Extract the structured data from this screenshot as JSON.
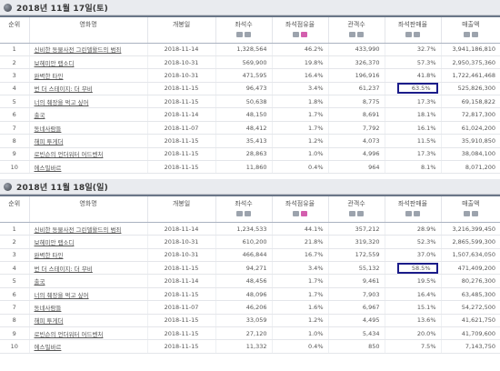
{
  "columns": [
    "순위",
    "영화명",
    "개봉일",
    "좌석수",
    "좌석점유율",
    "관객수",
    "좌석판매율",
    "매출액"
  ],
  "days": [
    {
      "title": "2018년 11월 17일(토)",
      "rows": [
        {
          "rank": "1",
          "title": "신비한 동물사전 그린델왈드의 범죄",
          "date": "2018-11-14",
          "seats": "1,328,564",
          "share": "46.2%",
          "audience": "433,990",
          "rate": "32.7%",
          "sales": "3,941,186,810"
        },
        {
          "rank": "2",
          "title": "보헤미안 랩소디",
          "date": "2018-10-31",
          "seats": "569,900",
          "share": "19.8%",
          "audience": "326,370",
          "rate": "57.3%",
          "sales": "2,950,375,360"
        },
        {
          "rank": "3",
          "title": "완벽한 타인",
          "date": "2018-10-31",
          "seats": "471,595",
          "share": "16.4%",
          "audience": "196,916",
          "rate": "41.8%",
          "sales": "1,722,461,468"
        },
        {
          "rank": "4",
          "title": "번 더 스테이지: 더 무비",
          "date": "2018-11-15",
          "seats": "96,473",
          "share": "3.4%",
          "audience": "61,237",
          "rate": "63.5%",
          "sales": "525,826,300",
          "hl": true
        },
        {
          "rank": "5",
          "title": "너의 췌장을 먹고 싶어",
          "date": "2018-11-15",
          "seats": "50,638",
          "share": "1.8%",
          "audience": "8,775",
          "rate": "17.3%",
          "sales": "69,158,822"
        },
        {
          "rank": "6",
          "title": "출국",
          "date": "2018-11-14",
          "seats": "48,150",
          "share": "1.7%",
          "audience": "8,691",
          "rate": "18.1%",
          "sales": "72,817,300"
        },
        {
          "rank": "7",
          "title": "동네사람들",
          "date": "2018-11-07",
          "seats": "48,412",
          "share": "1.7%",
          "audience": "7,792",
          "rate": "16.1%",
          "sales": "61,024,200"
        },
        {
          "rank": "8",
          "title": "해피 투게더",
          "date": "2018-11-15",
          "seats": "35,413",
          "share": "1.2%",
          "audience": "4,073",
          "rate": "11.5%",
          "sales": "35,910,850"
        },
        {
          "rank": "9",
          "title": "로빈슨의 언더워터 어드벤처",
          "date": "2018-11-15",
          "seats": "28,863",
          "share": "1.0%",
          "audience": "4,996",
          "rate": "17.3%",
          "sales": "38,084,100"
        },
        {
          "rank": "10",
          "title": "에스밀바르",
          "date": "2018-11-15",
          "seats": "11,860",
          "share": "0.4%",
          "audience": "964",
          "rate": "8.1%",
          "sales": "8,071,200"
        }
      ]
    },
    {
      "title": "2018년 11월 18일(일)",
      "rows": [
        {
          "rank": "1",
          "title": "신비한 동물사전 그린델왈드의 범죄",
          "date": "2018-11-14",
          "seats": "1,234,533",
          "share": "44.1%",
          "audience": "357,212",
          "rate": "28.9%",
          "sales": "3,216,399,450"
        },
        {
          "rank": "2",
          "title": "보헤미안 랩소디",
          "date": "2018-10-31",
          "seats": "610,200",
          "share": "21.8%",
          "audience": "319,320",
          "rate": "52.3%",
          "sales": "2,865,599,300"
        },
        {
          "rank": "3",
          "title": "완벽한 타인",
          "date": "2018-10-31",
          "seats": "466,844",
          "share": "16.7%",
          "audience": "172,559",
          "rate": "37.0%",
          "sales": "1,507,634,050"
        },
        {
          "rank": "4",
          "title": "번 더 스테이지: 더 무비",
          "date": "2018-11-15",
          "seats": "94,271",
          "share": "3.4%",
          "audience": "55,132",
          "rate": "58.5%",
          "sales": "471,409,200",
          "hl": true
        },
        {
          "rank": "5",
          "title": "출국",
          "date": "2018-11-14",
          "seats": "48,456",
          "share": "1.7%",
          "audience": "9,461",
          "rate": "19.5%",
          "sales": "80,276,300"
        },
        {
          "rank": "6",
          "title": "너의 췌장을 먹고 싶어",
          "date": "2018-11-15",
          "seats": "48,096",
          "share": "1.7%",
          "audience": "7,903",
          "rate": "16.4%",
          "sales": "63,485,300"
        },
        {
          "rank": "7",
          "title": "동네사람들",
          "date": "2018-11-07",
          "seats": "46,206",
          "share": "1.6%",
          "audience": "6,967",
          "rate": "15.1%",
          "sales": "54,272,500"
        },
        {
          "rank": "8",
          "title": "해피 투게더",
          "date": "2018-11-15",
          "seats": "33,059",
          "share": "1.2%",
          "audience": "4,495",
          "rate": "13.6%",
          "sales": "41,621,750"
        },
        {
          "rank": "9",
          "title": "로빈슨의 언더워터 어드벤처",
          "date": "2018-11-15",
          "seats": "27,120",
          "share": "1.0%",
          "audience": "5,434",
          "rate": "20.0%",
          "sales": "41,709,600"
        },
        {
          "rank": "10",
          "title": "에스밀바르",
          "date": "2018-11-15",
          "seats": "11,332",
          "share": "0.4%",
          "audience": "850",
          "rate": "7.5%",
          "sales": "7,143,750"
        }
      ]
    }
  ]
}
